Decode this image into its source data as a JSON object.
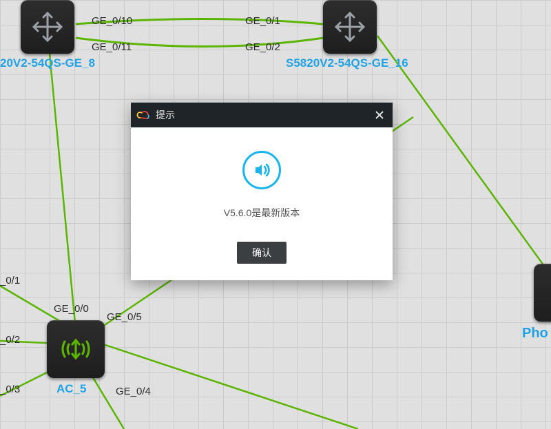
{
  "nodes": {
    "switch_left": {
      "label": "20V2-54QS-GE_8"
    },
    "switch_right": {
      "label": "S5820V2-54QS-GE_16"
    },
    "ac": {
      "label": "AC_5"
    },
    "phone": {
      "label": "Pho"
    }
  },
  "ports": {
    "p1": "GE_0/10",
    "p2": "GE_0/11",
    "p3": "GE_0/1",
    "p4": "GE_0/2",
    "p5": "_0/1",
    "p6": "GE_0/0",
    "p7": "GE_0/5",
    "p8": "_0/2",
    "p9": "_0/3",
    "p10": "GE_0/4"
  },
  "dialog": {
    "title": "提示",
    "message": "V5.6.0是最新版本",
    "confirm": "确认"
  }
}
